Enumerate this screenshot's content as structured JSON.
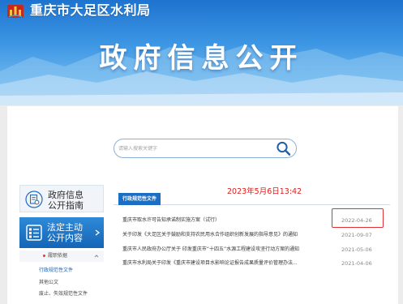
{
  "site": {
    "name": "重庆市大足区水利局",
    "banner_title": "政府信息公开"
  },
  "search": {
    "placeholder": "请输入搜索关键字"
  },
  "nav": {
    "guide": {
      "line1": "政府信息",
      "line2": "公开指南"
    },
    "active": {
      "line1": "法定主动",
      "line2": "公开内容"
    },
    "section": "履职依据",
    "items": [
      "行政规范性文件",
      "其他公文",
      "废止、失效规范性文件"
    ]
  },
  "list": {
    "category": "行政规范性文件",
    "annotation": "2023年5月6日13:42",
    "rows": [
      {
        "title": "重庆市取水许可告知承诺制实施方案（试行）",
        "date": "2022-04-26"
      },
      {
        "title": "关于印发《大足区关于鼓励和支持农民用水合作组织创新发展的指导意见》的通知",
        "date": "2021-09-07"
      },
      {
        "title": "重庆市人民政府办公厅关于 印发重庆市“十四五”水源工程建设攻坚行动方案的通知",
        "date": "2021-05-06"
      },
      {
        "title": "重庆市水利局关于印发《重庆市建设项目水影响论证报告成果质量评价管理办法...",
        "date": "2021-04-06"
      }
    ]
  },
  "colors": {
    "accent": "#1a6fc4",
    "annotation": "#e01b1b",
    "banner_top": "#1e73cf"
  }
}
